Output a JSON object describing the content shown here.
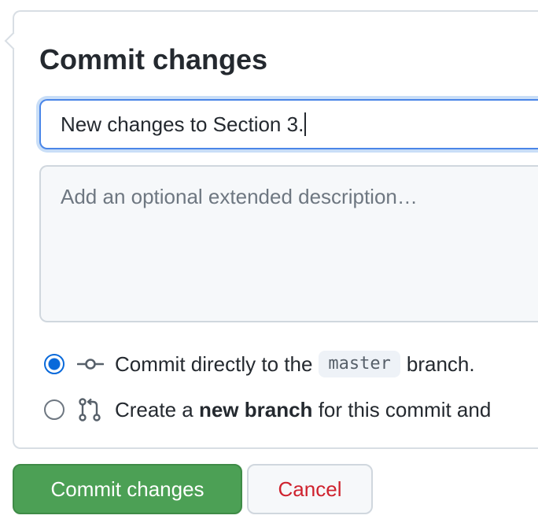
{
  "dialog": {
    "title": "Commit changes"
  },
  "summary": {
    "value": "New changes to Section 3."
  },
  "description": {
    "placeholder": "Add an optional extended description…"
  },
  "options": {
    "direct": {
      "text_before": "Commit directly to the",
      "branch": "master",
      "text_after": "branch.",
      "selected": true,
      "icon": "git-commit-icon"
    },
    "new_branch": {
      "text_before": "Create a",
      "bold": "new branch",
      "text_after": "for this commit and",
      "selected": false,
      "icon": "git-pull-request-icon"
    }
  },
  "buttons": {
    "commit": "Commit changes",
    "cancel": "Cancel"
  },
  "colors": {
    "commit_button": "#4ca055",
    "cancel_text": "#cf222e",
    "focus_border": "#4a86e8",
    "radio_selected": "#0969da"
  }
}
